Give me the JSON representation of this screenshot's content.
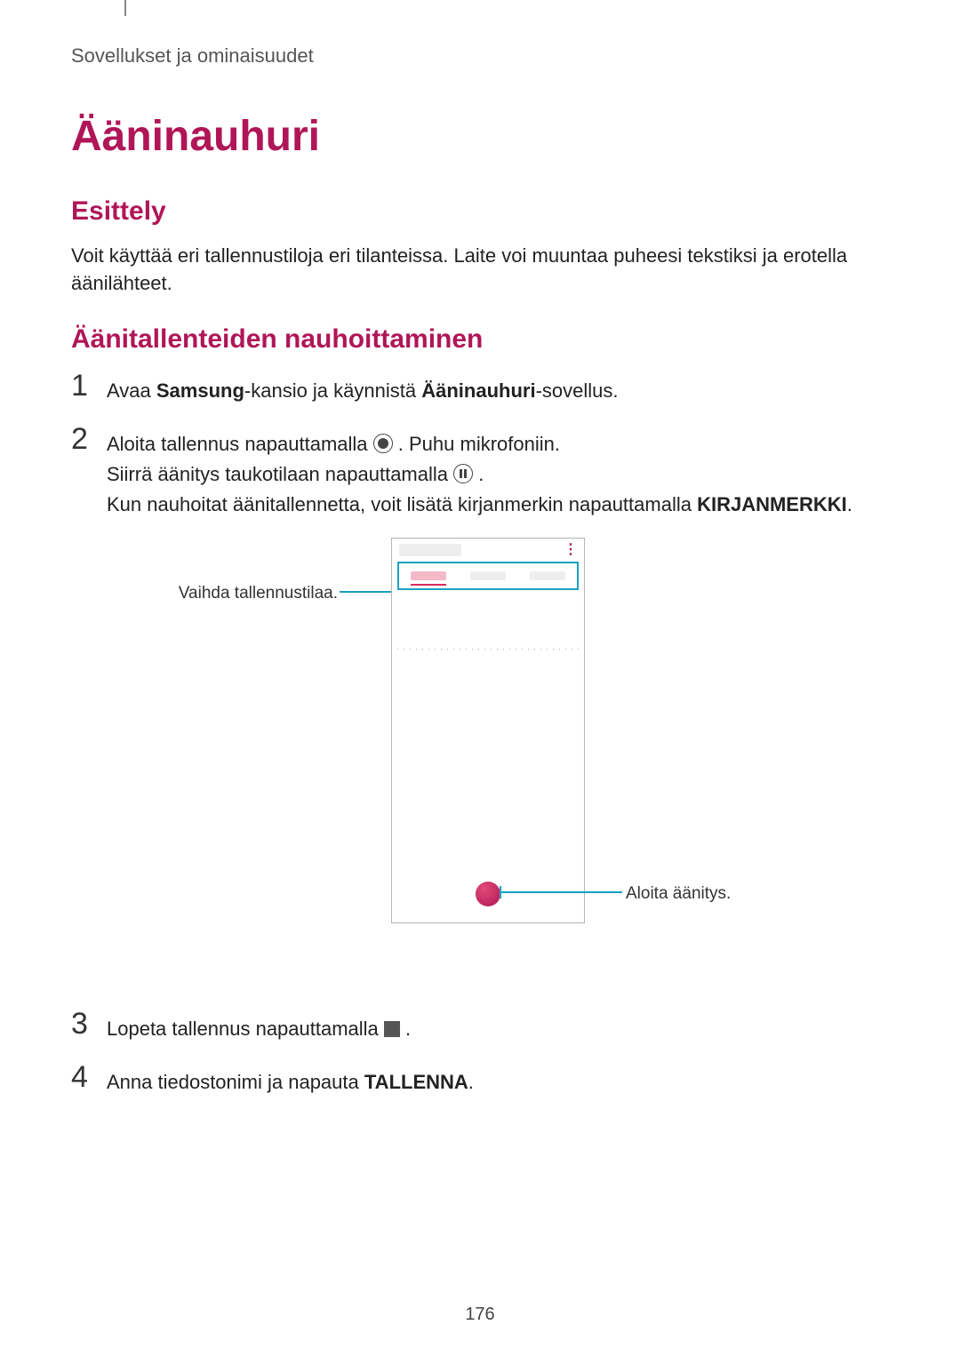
{
  "breadcrumb": "Sovellukset ja ominaisuudet",
  "title": "Ääninauhuri",
  "intro": {
    "heading": "Esittely",
    "body": "Voit käyttää eri tallennustiloja eri tilanteissa. Laite voi muuntaa puheesi tekstiksi ja erotella äänilähteet."
  },
  "recording": {
    "heading": "Äänitallenteiden nauhoittaminen"
  },
  "steps": {
    "s1": {
      "num": "1",
      "prefix": "Avaa ",
      "bold1": "Samsung",
      "mid": "-kansio ja käynnistä ",
      "bold2": "Ääninauhuri",
      "suffix": "-sovellus."
    },
    "s2": {
      "num": "2",
      "line1a": "Aloita tallennus napauttamalla ",
      "line1b": ". Puhu mikrofoniin.",
      "line2a": "Siirrä äänitys taukotilaan napauttamalla ",
      "line2b": ".",
      "line3a": "Kun nauhoitat äänitallennetta, voit lisätä kirjanmerkin napauttamalla ",
      "bold3": "KIRJANMERKKI",
      "line3b": "."
    },
    "s3": {
      "num": "3",
      "a": "Lopeta tallennus napauttamalla ",
      "b": "."
    },
    "s4": {
      "num": "4",
      "a": "Anna tiedostonimi ja napauta ",
      "bold4": "TALLENNA",
      "b": "."
    }
  },
  "figure": {
    "left_callout": "Vaihda tallennustilaa.",
    "right_callout": "Aloita äänitys."
  },
  "page_number": "176"
}
